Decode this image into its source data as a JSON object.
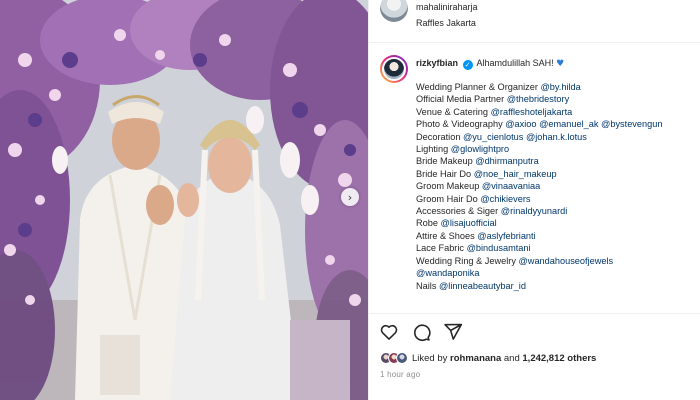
{
  "header": {
    "username": "mahaliniraharja",
    "location": "Raffles Jakarta"
  },
  "caption": {
    "username": "rizkyfbian",
    "text": "Alhamdulillah SAH!",
    "heart_icon": "blue-heart-icon",
    "lines": [
      {
        "label": "Wedding Planner & Organizer ",
        "tags": "@by.hilda"
      },
      {
        "label": "Official Media Partner ",
        "tags": "@thebridestory"
      },
      {
        "label": "Venue & Catering ",
        "tags": "@raffleshoteljakarta"
      },
      {
        "label": "Photo & Videography ",
        "tags": "@axioo @emanuel_ak @bystevengun"
      },
      {
        "label": "Decoration ",
        "tags": "@yu_cienlotus @johan.k.lotus"
      },
      {
        "label": "Lighting ",
        "tags": "@glowlightpro"
      },
      {
        "label": "Bride Makeup ",
        "tags": "@dhirmanputra"
      },
      {
        "label": "Bride Hair Do ",
        "tags": "@noe_hair_makeup"
      },
      {
        "label": "Groom Makeup ",
        "tags": "@vinaavaniaa"
      },
      {
        "label": "Groom Hair Do ",
        "tags": "@chikievers"
      },
      {
        "label": "Accessories & Siger ",
        "tags": "@rinaldyyunardi"
      },
      {
        "label": "Robe ",
        "tags": "@lisajuofficial"
      },
      {
        "label": "Attire & Shoes ",
        "tags": "@aslyfebrianti"
      },
      {
        "label": "Lace Fabric ",
        "tags": "@bindusamtani"
      },
      {
        "label": "Wedding Ring & Jewelry ",
        "tags": "@wandahouseofjewels"
      },
      {
        "label": "",
        "tags": "@wandaponika"
      },
      {
        "label": "Nails ",
        "tags": "@linneabeautybar_id"
      }
    ]
  },
  "actions": {
    "like_icon": "heart-icon",
    "comment_icon": "comment-icon",
    "share_icon": "share-icon"
  },
  "likes": {
    "prefix": "Liked by ",
    "user": "rohmanana",
    "middle": " and ",
    "count": "1,242,812 others"
  },
  "timestamp": "1 hour ago",
  "colors": {
    "link": "#00376b",
    "verified": "#0095f6",
    "muted": "#8e8e8e"
  }
}
